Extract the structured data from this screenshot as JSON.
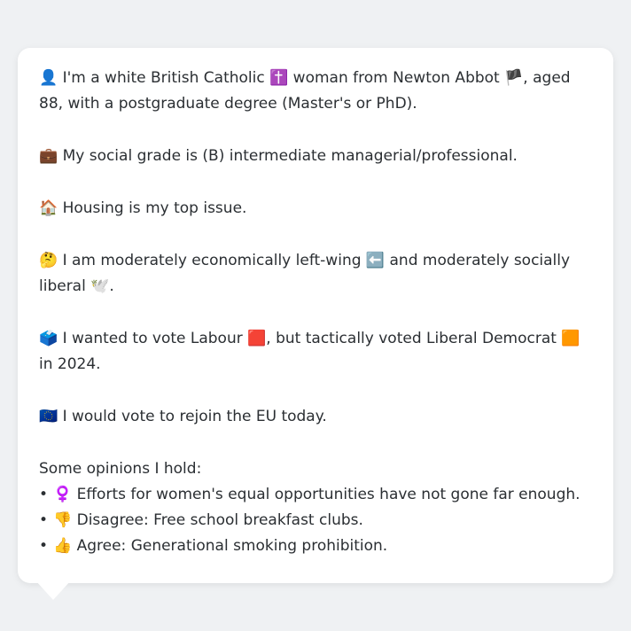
{
  "profile": {
    "identity": {
      "icon": "👤",
      "text_before": " I'm a white British Catholic ",
      "religion_icon": "✝️",
      "text_middle": " woman from Newton Abbot ",
      "flag_icon": "🏴",
      "text_after": ", aged 88, with a postgraduate degree (Master's or PhD)."
    },
    "social_grade": {
      "icon": "💼",
      "text": " My social grade is (B) intermediate managerial/professional."
    },
    "top_issue": {
      "icon": "🏠",
      "text": " Housing is my top issue."
    },
    "ideology": {
      "icon": "🤔",
      "text_before": " I am moderately economically left-wing ",
      "left_icon": "⬅️",
      "text_middle": " and moderately socially liberal ",
      "liberal_icon": "🕊️",
      "text_after": "."
    },
    "vote": {
      "icon": "🗳️",
      "text_before": " I wanted to vote Labour ",
      "labour_icon": "🟥",
      "text_middle": ", but tactically voted Liberal Democrat ",
      "libdem_icon": "🟧",
      "text_after": " in 2024."
    },
    "eu": {
      "icon": "🇪🇺",
      "text": " I would vote to rejoin the EU today."
    },
    "opinions": {
      "title": "Some opinions I hold:",
      "items": [
        {
          "bullet": "•",
          "icon": "♀️",
          "text": " Efforts for women's equal opportunities have not gone far enough."
        },
        {
          "bullet": "•",
          "icon": "👎",
          "text": " Disagree: Free school breakfast clubs."
        },
        {
          "bullet": "•",
          "icon": "👍",
          "text": " Agree: Generational smoking prohibition."
        }
      ]
    }
  },
  "colors": {
    "background": "#eff1f3",
    "card": "#ffffff",
    "text": "#2b2f33"
  }
}
